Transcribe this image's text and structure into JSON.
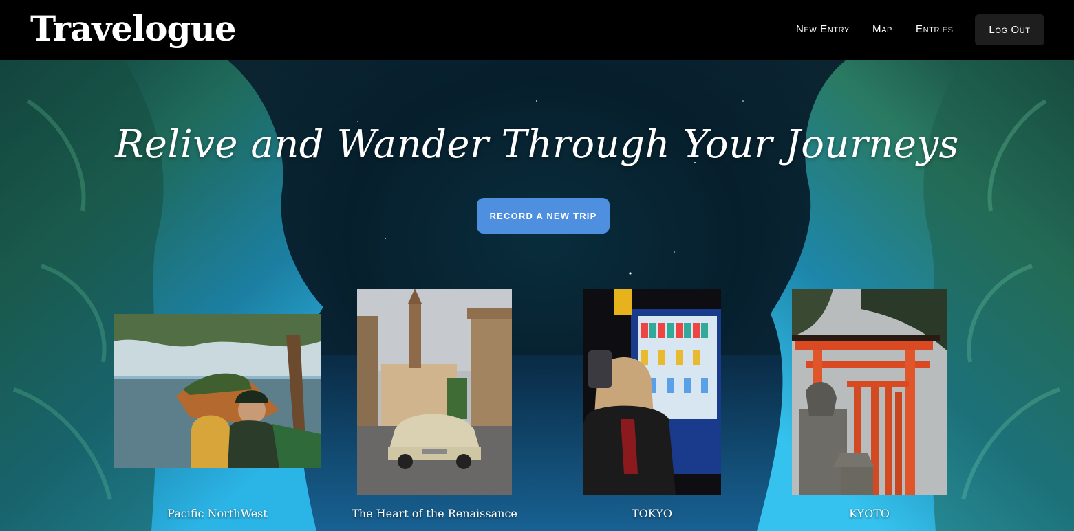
{
  "header": {
    "brand": "Travelogue",
    "nav": {
      "new_entry": "New Entry",
      "map": "Map",
      "entries": "Entries",
      "logout": "Log Out"
    }
  },
  "hero": {
    "title": "Relive and Wander Through Your Journeys",
    "cta_label": "Record a new trip"
  },
  "trips": [
    {
      "caption": "Pacific NorthWest",
      "photo": "coastal-selfie-photo"
    },
    {
      "caption": "The Heart of the Renaissance",
      "photo": "florence-vintage-car-photo"
    },
    {
      "caption": "TOKYO",
      "photo": "tokyo-vending-machine-photo"
    },
    {
      "caption": "KYOTO",
      "photo": "kyoto-torii-gates-photo"
    }
  ],
  "colors": {
    "header_bg": "#000000",
    "cta_bg": "#4f8fe0",
    "logout_bg": "#1e1e1e",
    "hero_teal": "#0b2a3a"
  }
}
